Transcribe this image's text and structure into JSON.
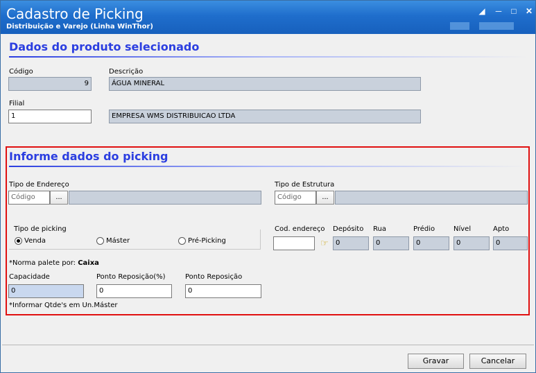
{
  "window": {
    "title": "Cadastro de Picking",
    "subtitle": "Distribuição e Varejo (Linha WinThor)"
  },
  "section1": {
    "title": "Dados do produto selecionado",
    "codigo_label": "Código",
    "codigo_value": "9",
    "descricao_label": "Descrição",
    "descricao_value": "ÁGUA MINERAL",
    "filial_label": "Filial",
    "filial_value": "1",
    "empresa_value": "EMPRESA WMS DISTRIBUICAO LTDA"
  },
  "section2": {
    "title": "Informe dados do picking",
    "tipo_endereco_label": "Tipo de Endereço",
    "tipo_endereco_placeholder": "Código",
    "tipo_estrutura_label": "Tipo de Estrutura",
    "tipo_estrutura_placeholder": "Código",
    "dots_label": "...",
    "tipo_picking_label": "Tipo de picking",
    "radio_venda": "Venda",
    "radio_master": "Máster",
    "radio_prepicking": "Pré-Picking",
    "cod_endereco_label": "Cod. endereço",
    "deposito_label": "Depósito",
    "deposito_value": "0",
    "rua_label": "Rua",
    "rua_value": "0",
    "predio_label": "Prédio",
    "predio_value": "0",
    "nivel_label": "Nível",
    "nivel_value": "0",
    "apto_label": "Apto",
    "apto_value": "0",
    "norma_label": "*Norma palete por:",
    "norma_value": "Caixa",
    "capacidade_label": "Capacidade",
    "capacidade_value": "0",
    "ponto_rep_pct_label": "Ponto Reposição(%)",
    "ponto_rep_pct_value": "0",
    "ponto_rep_label": "Ponto Reposição",
    "ponto_rep_value": "0",
    "informar_note": "*Informar Qtde's em Un.Máster"
  },
  "buttons": {
    "gravar": "Gravar",
    "cancelar": "Cancelar"
  }
}
